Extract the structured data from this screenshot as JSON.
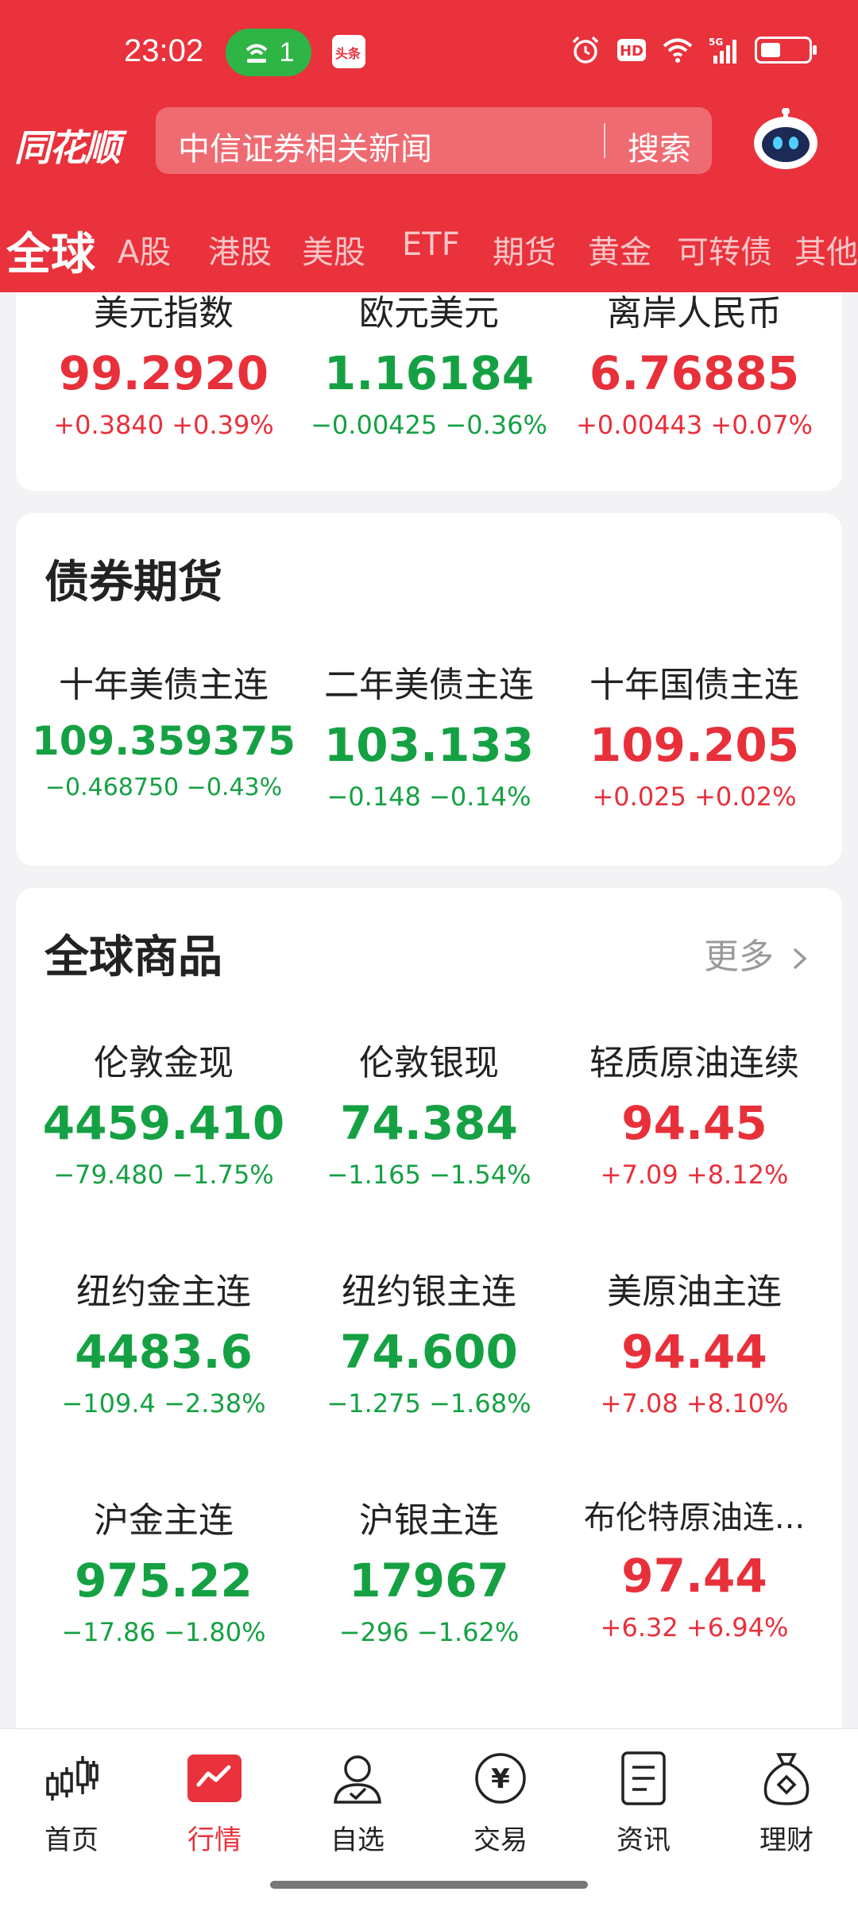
{
  "status_bar": {
    "time": "23:02",
    "hotspot_count": "1",
    "news_app": "头条",
    "network": "5G",
    "hd": "HD"
  },
  "header": {
    "logo": "同花顺",
    "search_placeholder": "中信证券相关新闻",
    "search_button": "搜索"
  },
  "tabs": [
    "全球",
    "A股",
    "港股",
    "美股",
    "ETF",
    "期货",
    "黄金",
    "可转债",
    "其他"
  ],
  "fx_card": {
    "items": [
      {
        "name": "美元指数",
        "value": "99.2920",
        "change": "+0.3840 +0.39%",
        "direction": "up"
      },
      {
        "name": "欧元美元",
        "value": "1.16184",
        "change": "−0.00425 −0.36%",
        "direction": "down"
      },
      {
        "name": "离岸人民币",
        "value": "6.76885",
        "change": "+0.00443 +0.07%",
        "direction": "up"
      }
    ]
  },
  "bond_card": {
    "title": "债券期货",
    "items": [
      {
        "name": "十年美债主连",
        "value": "109.359375",
        "change": "−0.468750 −0.43%",
        "direction": "down"
      },
      {
        "name": "二年美债主连",
        "value": "103.133",
        "change": "−0.148 −0.14%",
        "direction": "down"
      },
      {
        "name": "十年国债主连",
        "value": "109.205",
        "change": "+0.025 +0.02%",
        "direction": "up"
      }
    ]
  },
  "commodity_card": {
    "title": "全球商品",
    "more": "更多",
    "items": [
      {
        "name": "伦敦金现",
        "value": "4459.410",
        "change": "−79.480 −1.75%",
        "direction": "down"
      },
      {
        "name": "伦敦银现",
        "value": "74.384",
        "change": "−1.165 −1.54%",
        "direction": "down"
      },
      {
        "name": "轻质原油连续",
        "value": "94.45",
        "change": "+7.09 +8.12%",
        "direction": "up"
      },
      {
        "name": "纽约金主连",
        "value": "4483.6",
        "change": "−109.4 −2.38%",
        "direction": "down"
      },
      {
        "name": "纽约银主连",
        "value": "74.600",
        "change": "−1.275 −1.68%",
        "direction": "down"
      },
      {
        "name": "美原油主连",
        "value": "94.44",
        "change": "+7.08 +8.10%",
        "direction": "up"
      },
      {
        "name": "沪金主连",
        "value": "975.22",
        "change": "−17.86 −1.80%",
        "direction": "down"
      },
      {
        "name": "沪银主连",
        "value": "17967",
        "change": "−296 −1.62%",
        "direction": "down"
      },
      {
        "name": "布伦特原油连...",
        "value": "97.44",
        "change": "+6.32 +6.94%",
        "direction": "up"
      }
    ]
  },
  "bottom_nav": [
    {
      "label": "首页",
      "icon": "candlestick-icon"
    },
    {
      "label": "行情",
      "icon": "market-chart-icon"
    },
    {
      "label": "自选",
      "icon": "user-check-icon"
    },
    {
      "label": "交易",
      "icon": "yuan-coin-icon"
    },
    {
      "label": "资讯",
      "icon": "document-icon"
    },
    {
      "label": "理财",
      "icon": "money-bag-icon"
    }
  ],
  "colors": {
    "brand_red": "#e9323c",
    "up": "#e8303b",
    "down": "#15a143"
  }
}
